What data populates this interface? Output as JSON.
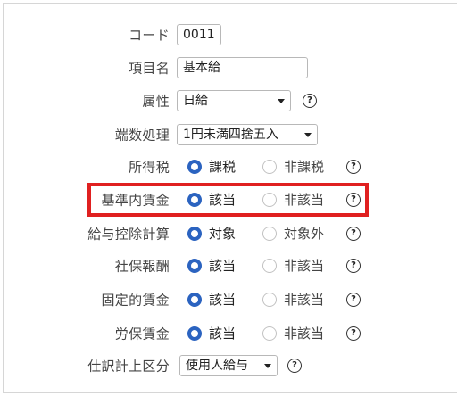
{
  "fields": {
    "code": {
      "label": "コード",
      "value": "0011"
    },
    "item_name": {
      "label": "項目名",
      "value": "基本給"
    },
    "attribute": {
      "label": "属性",
      "selected": "日給"
    },
    "rounding": {
      "label": "端数処理",
      "selected": "1円未満四捨五入"
    },
    "income_tax": {
      "label": "所得税",
      "option_on": "課税",
      "option_off": "非課税"
    },
    "standard_wage": {
      "label": "基準内賃金",
      "option_on": "該当",
      "option_off": "非該当"
    },
    "payroll_deduction": {
      "label": "給与控除計算",
      "option_on": "対象",
      "option_off": "対象外"
    },
    "social_insurance": {
      "label": "社保報酬",
      "option_on": "該当",
      "option_off": "非該当"
    },
    "fixed_wage": {
      "label": "固定的賃金",
      "option_on": "該当",
      "option_off": "非該当"
    },
    "labor_insurance": {
      "label": "労保賃金",
      "option_on": "該当",
      "option_off": "非該当"
    },
    "account_category": {
      "label": "仕訳計上区分",
      "selected": "使用人給与"
    }
  },
  "help_glyph": "?",
  "colors": {
    "radio_accent": "#2b63c0",
    "highlight": "#e02020"
  },
  "icons": {
    "help": "question-circle-icon",
    "dropdown": "chevron-down-icon"
  }
}
